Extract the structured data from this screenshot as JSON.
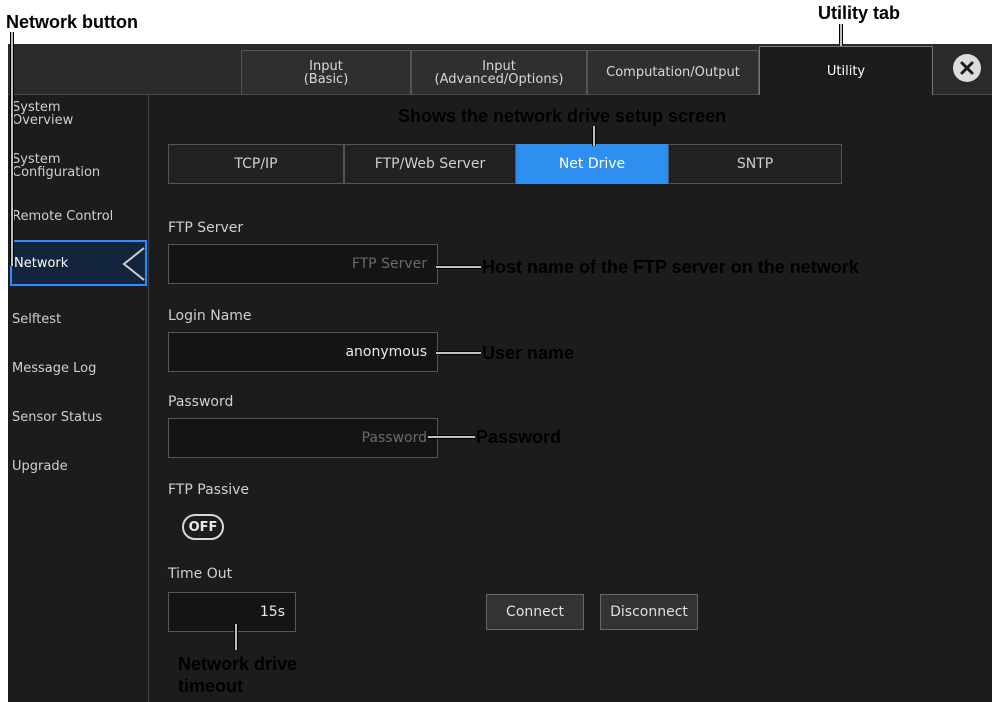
{
  "annotations": {
    "network_button": "Network button",
    "utility_tab": "Utility tab",
    "net_drive_caption": "Shows the network drive setup screen",
    "ftp_server_desc": "Host name of the FTP server on the network",
    "login_desc": "User name",
    "password_desc": "Password",
    "timeout_desc_line1": "Network drive",
    "timeout_desc_line2": "timeout"
  },
  "tabs": [
    {
      "label": "Input\n(Basic)"
    },
    {
      "label": "Input\n(Advanced/Options)"
    },
    {
      "label": "Computation/Output"
    },
    {
      "label": "Utility",
      "active": true
    }
  ],
  "sidebar": {
    "items": [
      {
        "label": "System\nOverview"
      },
      {
        "label": "System\nConfiguration"
      },
      {
        "label": "Remote Control"
      },
      {
        "label": "Network",
        "active": true
      },
      {
        "label": "Selftest"
      },
      {
        "label": "Message Log"
      },
      {
        "label": "Sensor Status"
      },
      {
        "label": "Upgrade"
      }
    ]
  },
  "subtabs": [
    {
      "label": "TCP/IP"
    },
    {
      "label": "FTP/Web Server"
    },
    {
      "label": "Net Drive",
      "active": true
    },
    {
      "label": "SNTP"
    }
  ],
  "form": {
    "ftp_server": {
      "label": "FTP Server",
      "value": "",
      "placeholder": "FTP Server"
    },
    "login_name": {
      "label": "Login Name",
      "value": "anonymous"
    },
    "password": {
      "label": "Password",
      "value": "",
      "placeholder": "Password"
    },
    "ftp_passive": {
      "label": "FTP Passive",
      "state": "OFF"
    },
    "time_out": {
      "label": "Time Out",
      "value": "15s"
    }
  },
  "buttons": {
    "connect": "Connect",
    "disconnect": "Disconnect"
  },
  "colors": {
    "accent": "#2f8ff0",
    "background": "#1c1c1c",
    "selected_border": "#2d8cff"
  }
}
